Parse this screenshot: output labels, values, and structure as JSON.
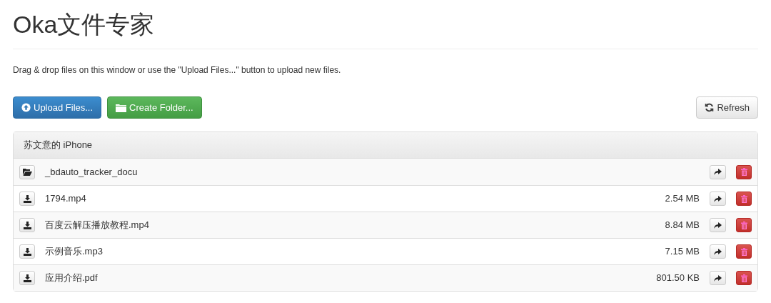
{
  "title": "Oka文件专家",
  "hint": "Drag & drop files on this window or use the \"Upload Files...\" button to upload new files.",
  "buttons": [
    {
      "kind": "upload",
      "label": "Upload Files..."
    },
    {
      "kind": "folder",
      "label": "Create Folder..."
    },
    {
      "kind": "refresh",
      "label": "Refresh"
    }
  ],
  "panel": {
    "title": "苏文意的 iPhone",
    "rows": [
      {
        "kind": "folder",
        "name": "_bdauto_tracker_docu"
      },
      {
        "kind": "file",
        "name": "1794.mp4",
        "size": "2.54 MB"
      },
      {
        "kind": "file",
        "name": "百度云解压播放教程.mp4",
        "size": "8.84 MB"
      },
      {
        "kind": "file",
        "name": "示例音乐.mp3",
        "size": "7.15 MB"
      },
      {
        "kind": "file",
        "name": "应用介绍.pdf",
        "size": "801.50 KB"
      }
    ]
  }
}
